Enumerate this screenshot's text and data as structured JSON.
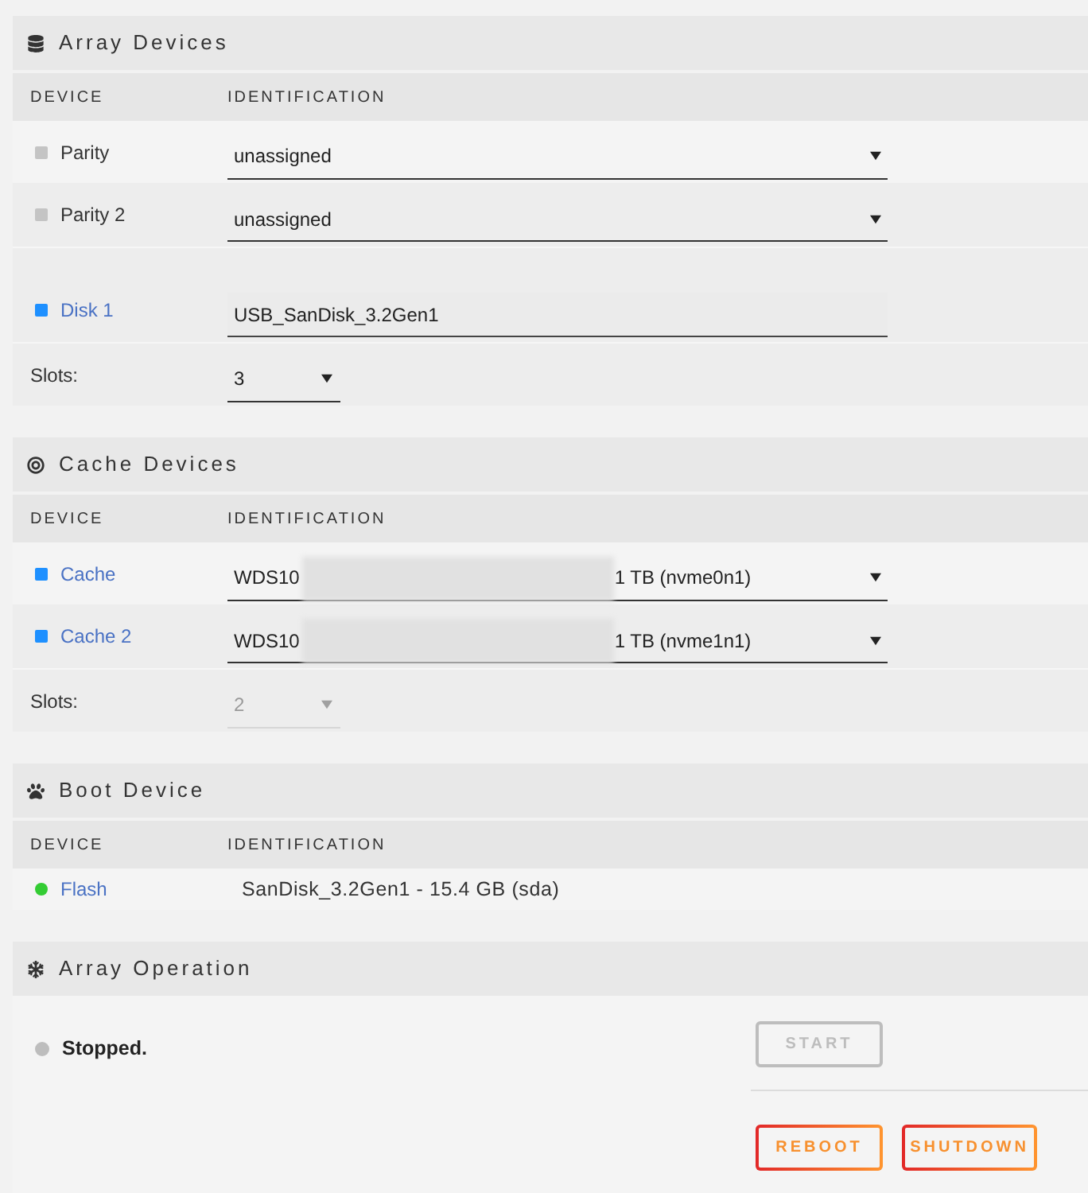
{
  "sections": [
    {
      "kind": "devices",
      "title": "Array Devices",
      "columns": [
        "DEVICE",
        "IDENTIFICATION"
      ],
      "rows": [
        {
          "kind": "disk",
          "name": "Parity",
          "assigned": false,
          "color": "#c4c4c4",
          "field": {
            "kind": "select",
            "value": "unassigned",
            "redacted": false
          }
        },
        {
          "kind": "disk",
          "name": "Parity 2",
          "assigned": false,
          "color": "#c4c4c4",
          "field": {
            "kind": "select",
            "value": "unassigned",
            "redacted": false
          }
        },
        {
          "kind": "spacer"
        },
        {
          "kind": "disk",
          "name": "Disk 1",
          "assigned": true,
          "color": "#1e90ff",
          "field": {
            "kind": "input",
            "value": "USB_SanDisk_3.2Gen1"
          }
        },
        {
          "kind": "slots",
          "label": "Slots:",
          "value": "3",
          "disabled": false
        }
      ]
    },
    {
      "kind": "devices",
      "title": "Cache Devices",
      "columns": [
        "DEVICE",
        "IDENTIFICATION"
      ],
      "rows": [
        {
          "kind": "disk",
          "name": "Cache",
          "assigned": true,
          "color": "#1e90ff",
          "field": {
            "kind": "select",
            "value": "WDS10",
            "redacted": true,
            "value_end": "1 TB (nvme0n1)"
          }
        },
        {
          "kind": "disk",
          "name": "Cache 2",
          "assigned": true,
          "color": "#1e90ff",
          "field": {
            "kind": "select",
            "value": "WDS10",
            "redacted": true,
            "value_end": "1 TB (nvme1n1)"
          }
        },
        {
          "kind": "slots",
          "label": "Slots:",
          "value": "2",
          "disabled": true
        }
      ]
    },
    {
      "kind": "devices",
      "title": "Boot Device",
      "columns": [
        "DEVICE",
        "IDENTIFICATION"
      ],
      "rows": [
        {
          "kind": "boot",
          "name": "Flash",
          "assigned": true,
          "color": "#33cc33",
          "field": {
            "kind": "text",
            "value": "SanDisk_3.2Gen1 - 15.4 GB (sda)"
          }
        }
      ]
    },
    {
      "kind": "operation",
      "title": "Array Operation",
      "status": {
        "label": "Stopped.",
        "color": "#bdbdbd"
      },
      "button_rows": [
        [
          {
            "label": "START",
            "disabled": true
          }
        ],
        [
          {
            "label": "REBOOT",
            "disabled": false
          },
          {
            "label": "SHUTDOWN",
            "disabled": false
          }
        ]
      ]
    }
  ]
}
